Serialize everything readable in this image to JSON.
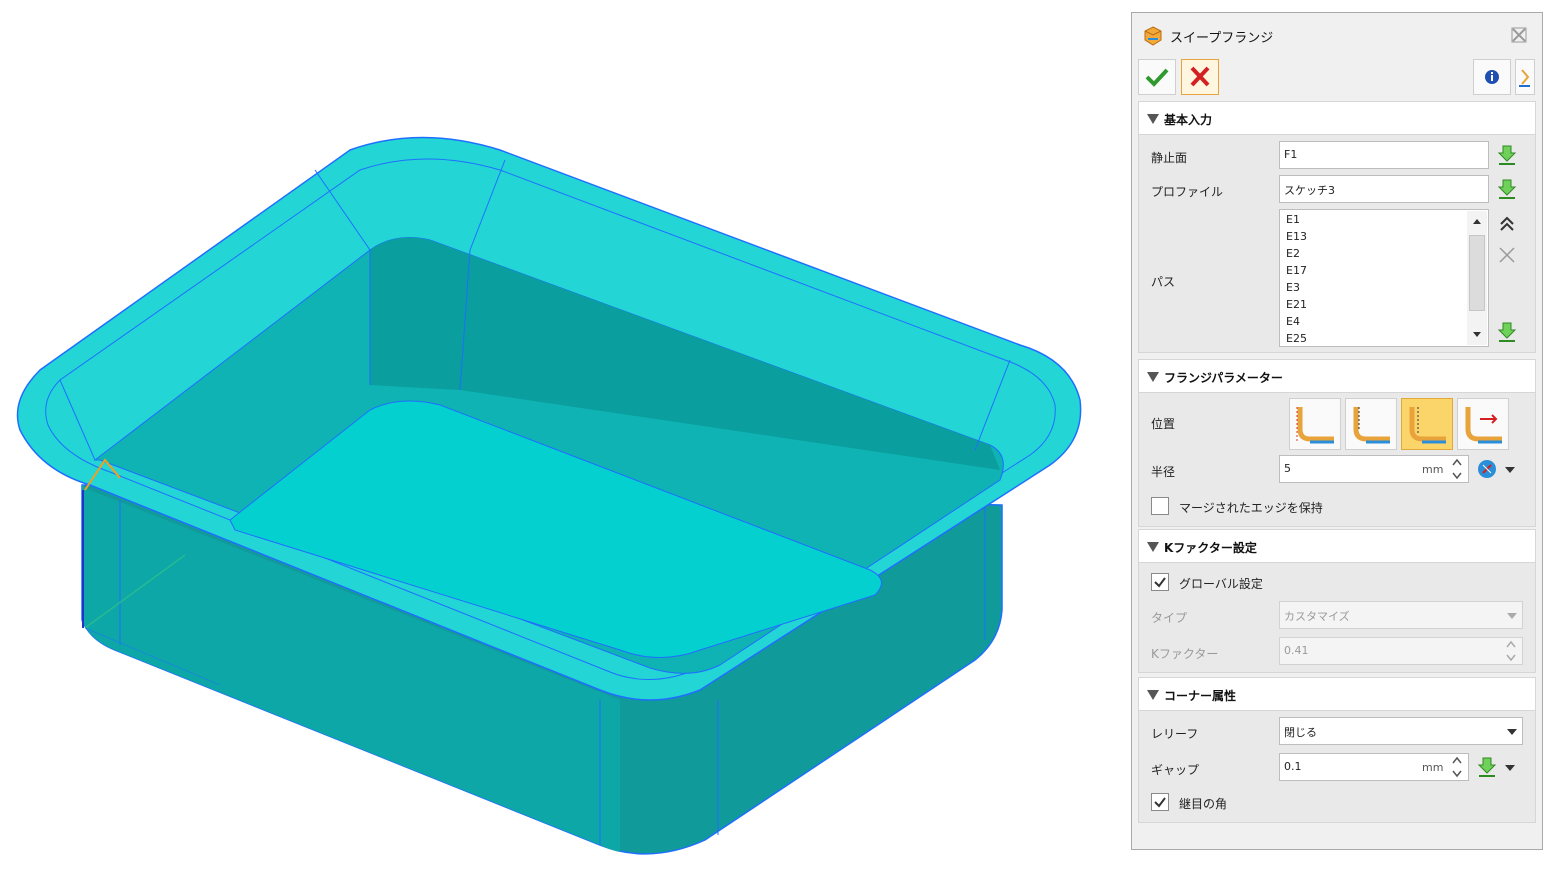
{
  "panel": {
    "title": "スイープフランジ",
    "sections": {
      "basic": {
        "label": "基本入力",
        "stationary_face_label": "静止面",
        "stationary_face_value": "F1",
        "profile_label": "プロファイル",
        "profile_value": "スケッチ3",
        "path_label": "パス",
        "path_items": [
          "E1",
          "E13",
          "E2",
          "E17",
          "E3",
          "E21",
          "E4",
          "E25"
        ]
      },
      "flange": {
        "label": "フランジパラメーター",
        "position_label": "位置",
        "position_selected": 3,
        "radius_label": "半径",
        "radius_value": "5",
        "radius_unit": "mm",
        "keep_merged_label": "マージされたエッジを保持",
        "keep_merged_checked": false
      },
      "kfactor": {
        "label": "Kファクター設定",
        "global_label": "グローバル設定",
        "global_checked": true,
        "type_label": "タイプ",
        "type_value": "カスタマイズ",
        "kfactor_label": "Kファクター",
        "kfactor_value": "0.41"
      },
      "corner": {
        "label": "コーナー属性",
        "relief_label": "レリーフ",
        "relief_value": "閉じる",
        "gap_label": "ギャップ",
        "gap_value": "0.1",
        "gap_unit": "mm",
        "seam_corner_label": "継目の角",
        "seam_corner_checked": true
      }
    }
  },
  "colors": {
    "model_top": "#23d5d5",
    "model_inner": "#0fb3b3",
    "model_side": "#119a9a",
    "edge": "#1e6fff",
    "accent": "#e8a33b",
    "pick_green": "#3aa528"
  }
}
